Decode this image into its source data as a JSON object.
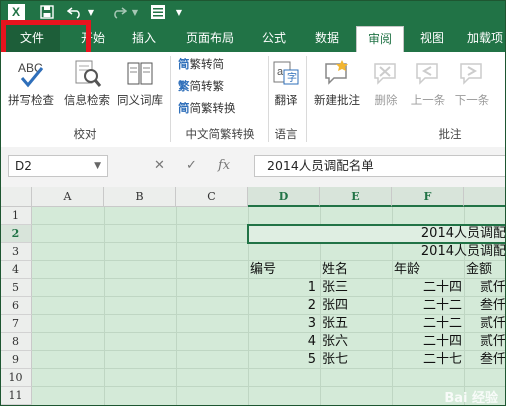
{
  "qat": {
    "logo_text": "X"
  },
  "tabs": [
    "文件",
    "开始",
    "插入",
    "页面布局",
    "公式",
    "数据",
    "审阅",
    "视图",
    "加载项"
  ],
  "ribbon": {
    "proofing": {
      "spelling": "拼写检查",
      "research": "信息检索",
      "thesaurus": "同义词库",
      "group": "校对"
    },
    "chinese": {
      "to_trad": "繁转简",
      "to_simp": "简转繁",
      "convert": "简繁转换",
      "group": "中文简繁转换"
    },
    "language": {
      "translate": "翻译",
      "group": "语言"
    },
    "comments": {
      "new_comment": "新建批注",
      "delete": "删除",
      "previous": "上一条",
      "next": "下一条",
      "group": "批注"
    }
  },
  "formula_bar": {
    "name_box": "D2",
    "cancel": "✕",
    "enter": "✓",
    "fx": "fx",
    "value": "2014人员调配名单"
  },
  "columns": [
    "A",
    "B",
    "C",
    "D",
    "E",
    "F"
  ],
  "rows": [
    "1",
    "2",
    "3",
    "4",
    "5",
    "6",
    "7",
    "8",
    "9",
    "10",
    "11"
  ],
  "cells": {
    "r2_title": "2014人员调配",
    "r3_title": "2014人员调配",
    "headers": [
      "编号",
      "姓名",
      "年龄",
      "金额"
    ],
    "data": [
      {
        "no": "1",
        "name": "张三",
        "age": "二十四",
        "amount": "贰仟"
      },
      {
        "no": "2",
        "name": "张四",
        "age": "二十二",
        "amount": "叁仟"
      },
      {
        "no": "3",
        "name": "张五",
        "age": "二十二",
        "amount": "贰仟"
      },
      {
        "no": "4",
        "name": "张六",
        "age": "二十四",
        "amount": "贰仟"
      },
      {
        "no": "5",
        "name": "张七",
        "age": "二十七",
        "amount": "叁仟"
      }
    ]
  },
  "watermark": "Bai 经验"
}
